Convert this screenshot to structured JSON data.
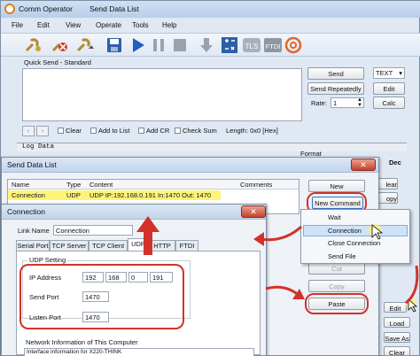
{
  "main_window": {
    "title": "Comm Operator",
    "tab": "Send Data List",
    "menu": [
      "File",
      "Edit",
      "View",
      "Operate",
      "Tools",
      "Help"
    ],
    "toolbar_icons": [
      "connect-icon",
      "disconnect-icon",
      "connect-all-icon",
      "save-icon",
      "play-icon",
      "pause-icon",
      "stop-icon",
      "down-arrow-icon",
      "calculator-icon",
      "tls-icon",
      "ftdi-icon",
      "at-icon"
    ],
    "tls_label": "TLS",
    "ftdi_label": "FTDI",
    "quick_send_label": "Quick Send - Standard",
    "send_button": "Send",
    "mode_select": "TEXT",
    "send_repeatedly_button": "Send Repeatedly",
    "edit_button": "Edit",
    "rate_label": "Rate:",
    "rate_value": "1",
    "calc_button": "Calc",
    "options": [
      "Clear",
      "Add to List",
      "Add CR",
      "Check Sum"
    ],
    "length_text": "Length: 0x0 [Hex]",
    "log_data_label": "Log Data",
    "format_label": "Format",
    "dec_label": "Dec",
    "dec_partial": "Dec",
    "right_partial_buttons": [
      "lear",
      "opy"
    ],
    "edit2_button": "Edit",
    "load_button": "Load",
    "save_as_button": "Save As",
    "clear2_button": "Clear"
  },
  "send_data_list": {
    "title": "Send Data List",
    "columns": [
      "Name",
      "Type",
      "Content",
      "Comments"
    ],
    "row": {
      "name": "Connection",
      "type": "UDP",
      "content": "UDP IP:192.168.0.191 In:1470 Out: 1470"
    },
    "new_button": "New",
    "new_command_button": "New Command",
    "cut_button": "Cut",
    "copy_button": "Copy",
    "paste_button": "Paste",
    "context_menu": [
      "Wait",
      "Connection",
      "Close Connection",
      "Send File"
    ]
  },
  "connection_dialog": {
    "title": "Connection",
    "link_name_label": "Link Name",
    "link_name_value": "Connection",
    "tabs": [
      "Serial Port",
      "TCP Server",
      "TCP Client",
      "UDP",
      "HTTP",
      "FTDI"
    ],
    "udp_setting_label": "UDP Setting",
    "ip_label": "IP Address",
    "ip": [
      "192",
      "168",
      "0",
      "191"
    ],
    "send_port_label": "Send Port",
    "send_port_value": "1470",
    "listen_port_label": "Listen Port",
    "listen_port_value": "1470",
    "network_info_label": "Network Information of This Computer",
    "network_info_partial": "Interface information for X220-THINK"
  }
}
